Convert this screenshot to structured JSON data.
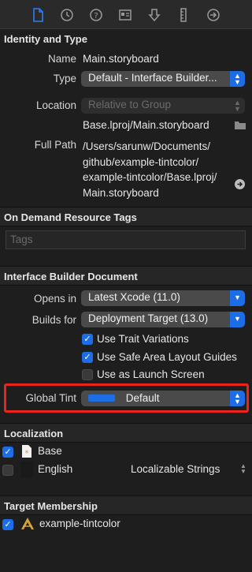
{
  "toolbar": {
    "icons": [
      "file-icon",
      "history-icon",
      "help-icon",
      "identity-icon",
      "attributes-icon",
      "size-icon",
      "connections-icon"
    ]
  },
  "identity": {
    "header": "Identity and Type",
    "name_label": "Name",
    "name_value": "Main.storyboard",
    "type_label": "Type",
    "type_value": "Default - Interface Builder...",
    "location_label": "Location",
    "location_value": "Relative to Group",
    "location_file": "Base.lproj/Main.storyboard",
    "fullpath_label": "Full Path",
    "fullpath_lines": [
      "/Users/sarunw/Documents/",
      "github/example-tintcolor/",
      "example-tintcolor/Base.lproj/",
      "Main.storyboard"
    ]
  },
  "on_demand": {
    "header": "On Demand Resource Tags",
    "tags_placeholder": "Tags"
  },
  "ib_document": {
    "header": "Interface Builder Document",
    "opens_in_label": "Opens in",
    "opens_in_value": "Latest Xcode (11.0)",
    "builds_for_label": "Builds for",
    "builds_for_value": "Deployment Target (13.0)",
    "checkboxes": [
      {
        "label": "Use Trait Variations",
        "checked": true
      },
      {
        "label": "Use Safe Area Layout Guides",
        "checked": true
      },
      {
        "label": "Use as Launch Screen",
        "checked": false
      }
    ],
    "global_tint_label": "Global Tint",
    "global_tint_value": "Default",
    "global_tint_color": "#1d6ee6"
  },
  "localization": {
    "header": "Localization",
    "items": [
      {
        "label": "Base",
        "checked": true,
        "option": ""
      },
      {
        "label": "English",
        "checked": false,
        "option": "Localizable Strings"
      }
    ]
  },
  "target": {
    "header": "Target Membership",
    "items": [
      {
        "label": "example-tintcolor",
        "checked": true
      }
    ]
  },
  "colors": {
    "accent": "#1d6ee6",
    "highlight": "#e8241b"
  }
}
